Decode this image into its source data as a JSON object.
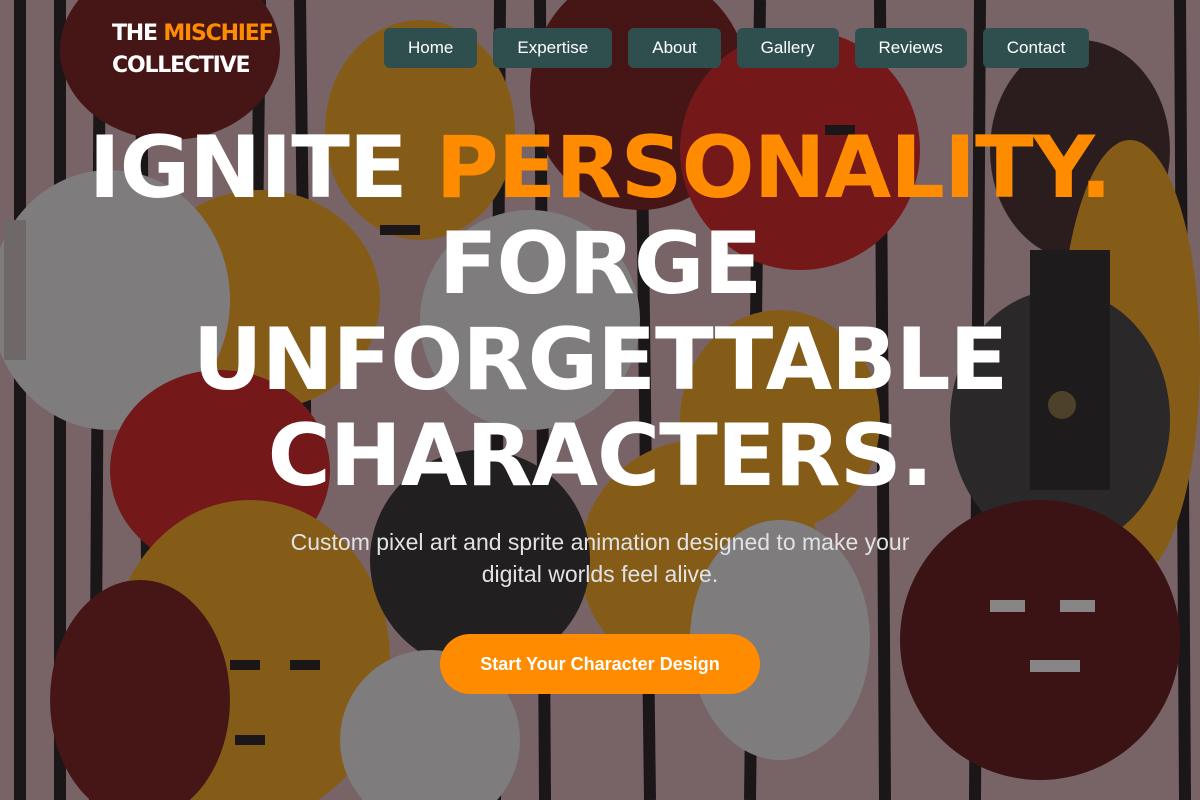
{
  "brand": {
    "name_prefix": "THE",
    "name_accent": "MISCHIEF",
    "name_line2": "COLLECTIVE"
  },
  "nav": {
    "items": [
      {
        "label": "Home"
      },
      {
        "label": "Expertise"
      },
      {
        "label": "About"
      },
      {
        "label": "Gallery"
      },
      {
        "label": "Reviews"
      },
      {
        "label": "Contact"
      }
    ]
  },
  "hero": {
    "headline_line1_white": "IGNITE",
    "headline_line1_accent": "PERSONALITY.",
    "headline_line2": "FORGE",
    "headline_line3": "UNFORGETTABLE",
    "headline_line4": "CHARACTERS.",
    "subheadline": "Custom pixel art and sprite animation designed to make your digital worlds feel alive.",
    "cta_label": "Start Your Character Design"
  },
  "colors": {
    "accent": "#ff8c00",
    "nav_button": "#2f4f4f",
    "text": "#ffffff"
  },
  "background": {
    "image": "painted mural of cartoon faces"
  }
}
